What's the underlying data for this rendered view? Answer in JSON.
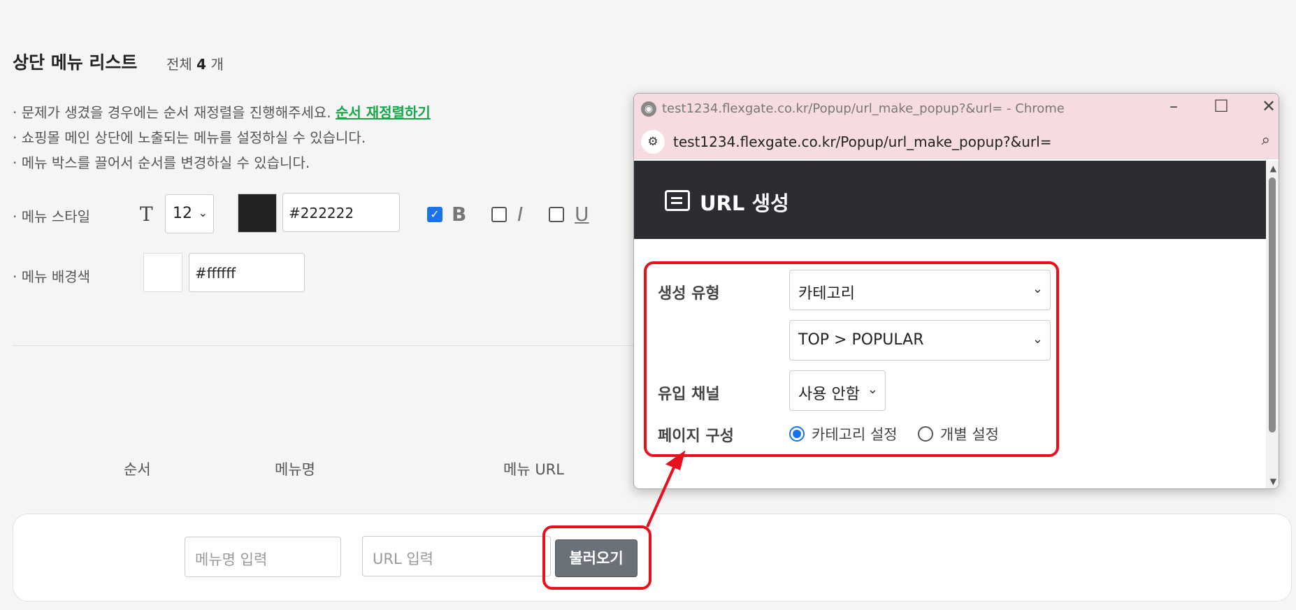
{
  "page": {
    "title": "상단 메뉴 리스트",
    "total_prefix": "전체",
    "total_count": "4",
    "total_suffix": "개"
  },
  "notes": {
    "line1": "· 문제가 생겼을 경우에는 순서 재정렬을 진행해주세요.",
    "reorder_link": "순서 재정렬하기",
    "line2": "· 쇼핑몰 메인 상단에 노출되는 메뉴를 설정하실 수 있습니다.",
    "line3": "· 메뉴 박스를 끌어서 순서를 변경하실 수 있습니다."
  },
  "menu_style": {
    "label": "· 메뉴 스타일",
    "t_icon": "T",
    "font_size": "12",
    "text_color": "#222222",
    "bold_label": "B",
    "italic_label": "I",
    "underline_label": "U",
    "bold_checked": true,
    "italic_checked": false,
    "underline_checked": false
  },
  "menu_bg": {
    "label": "· 메뉴 배경색",
    "color": "#ffffff"
  },
  "table": {
    "columns": [
      "순서",
      "메뉴명",
      "메뉴 URL"
    ]
  },
  "new_row": {
    "name_placeholder": "메뉴명 입력",
    "url_placeholder": "URL 입력",
    "load_button": "불러오기"
  },
  "popup": {
    "window_title": "test1234.flexgate.co.kr/Popup/url_make_popup?&url= - Chrome",
    "address": "test1234.flexgate.co.kr/Popup/url_make_popup?&url=",
    "header_title": "URL 생성",
    "form": {
      "type_label": "생성 유형",
      "type_value": "카테고리",
      "category_value": "TOP > POPULAR",
      "channel_label": "유입 채널",
      "channel_value": "사용 안함",
      "page_label": "페이지 구성",
      "radio_category": "카테고리 설정",
      "radio_individual": "개별 설정"
    }
  },
  "colors": {
    "highlight": "#e8101c",
    "link_green": "#19a64a",
    "header_dark": "#2c2d33"
  }
}
